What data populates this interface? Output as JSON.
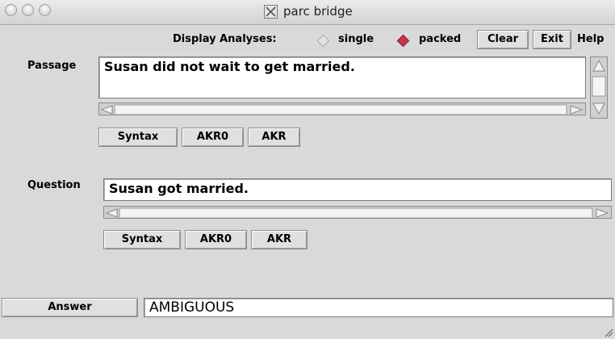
{
  "window": {
    "title": "parc bridge"
  },
  "toolbar": {
    "display_label": "Display Analyses:",
    "options": [
      {
        "label": "single",
        "selected": false
      },
      {
        "label": "packed",
        "selected": true
      }
    ],
    "clear_label": "Clear",
    "exit_label": "Exit",
    "help_label": "Help"
  },
  "passage": {
    "label": "Passage",
    "text": "Susan did not wait to get married.",
    "buttons": [
      "Syntax",
      "AKR0",
      "AKR"
    ]
  },
  "question": {
    "label": "Question",
    "text": "Susan got married.",
    "buttons": [
      "Syntax",
      "AKR0",
      "AKR"
    ]
  },
  "answer": {
    "button_label": "Answer",
    "value": "AMBIGUOUS"
  },
  "colors": {
    "window_bg": "#d9d9d9",
    "radio_selected": "#c8344a",
    "field_bg": "#ffffff"
  },
  "icons": [
    "close-icon",
    "minimize-icon",
    "zoom-icon",
    "x11-app-icon",
    "arrow-left-icon",
    "arrow-right-icon",
    "arrow-up-icon",
    "arrow-down-icon",
    "resize-grip-icon"
  ]
}
